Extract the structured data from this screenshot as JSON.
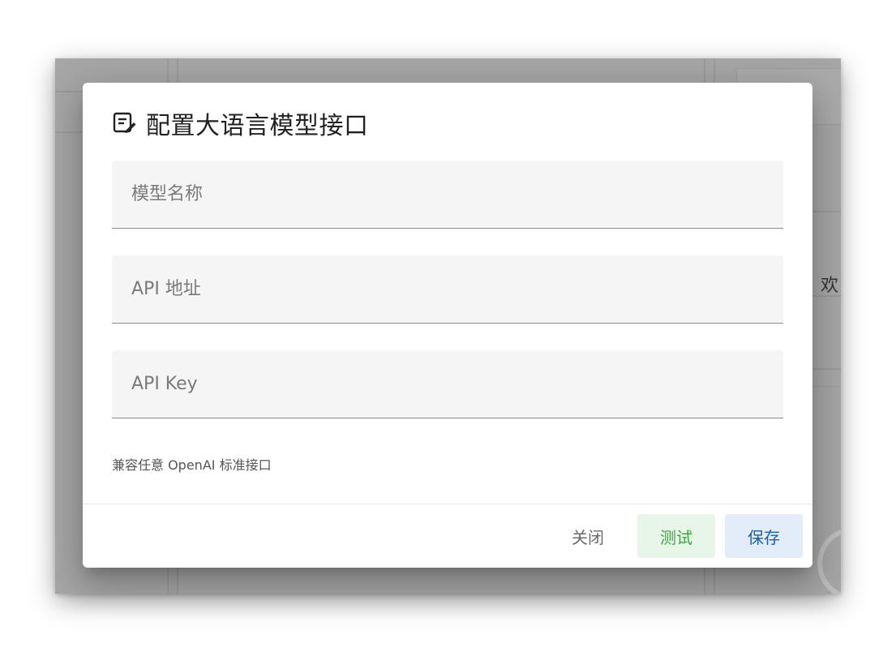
{
  "background": {
    "partial_text": "欢"
  },
  "dialog": {
    "icon": "edit-note-icon",
    "title": "配置大语言模型接口",
    "fields": [
      {
        "placeholder": "模型名称",
        "value": ""
      },
      {
        "placeholder": "API 地址",
        "value": ""
      },
      {
        "placeholder": "API Key",
        "value": ""
      }
    ],
    "hint": "兼容任意 OpenAI 标准接口",
    "buttons": {
      "close": "关闭",
      "test": "测试",
      "save": "保存"
    },
    "colors": {
      "test_text": "#43a047",
      "test_bg": "#e8f5e9",
      "save_text": "#1e5fa8",
      "save_bg": "#e3edf9"
    }
  }
}
